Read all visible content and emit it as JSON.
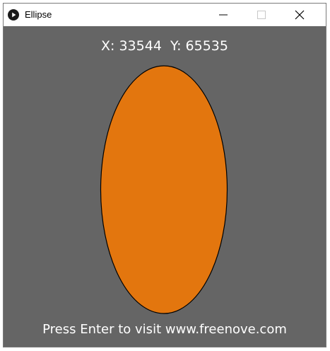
{
  "window": {
    "title": "Ellipse",
    "icon": "processing-play-icon",
    "controls": {
      "minimize": "minimize-icon",
      "maximize": "maximize-icon",
      "close": "close-icon"
    }
  },
  "canvas": {
    "background_color": "#656565",
    "coords": {
      "x_label": "X:",
      "x_value": "33544",
      "y_label": "Y:",
      "y_value": "65535"
    },
    "ellipse": {
      "fill_color": "#E3760E",
      "stroke_color": "#000000"
    },
    "footer": "Press Enter to visit www.freenove.com"
  }
}
